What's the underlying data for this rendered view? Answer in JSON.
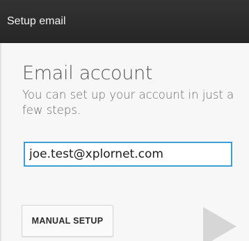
{
  "action_bar": {
    "title": "Setup email"
  },
  "main": {
    "heading": "Email account",
    "subtext": "You can set up your account in just a few steps.",
    "email_field": {
      "value": "joe.test@xplornet.com"
    },
    "manual_setup_label": "MANUAL SETUP",
    "next_icon": "play-arrow-icon"
  },
  "colors": {
    "action_bar": "#2b2b2b",
    "input_border": "#3b9fd4",
    "next_arrow": "#d6d6d6"
  }
}
